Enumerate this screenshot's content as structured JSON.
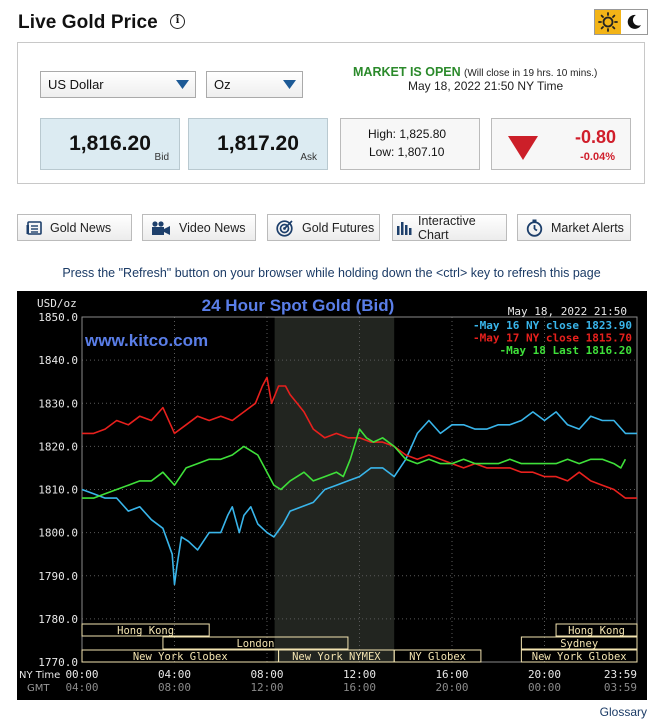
{
  "header": {
    "title": "Live Gold Price"
  },
  "selects": {
    "currency": "US Dollar",
    "unit": "Oz"
  },
  "market": {
    "status": "MARKET IS OPEN",
    "closes": "(Will close in 19 hrs. 10 mins.)",
    "time": "May 18, 2022 21:50 NY Time"
  },
  "prices": {
    "bid": "1,816.20",
    "bid_label": "Bid",
    "ask": "1,817.20",
    "ask_label": "Ask",
    "high": "High: 1,825.80",
    "low": "Low: 1,807.10",
    "change": "-0.80",
    "change_pct": "-0.04%"
  },
  "buttons": [
    {
      "label": "Gold News",
      "icon": "newspaper-icon"
    },
    {
      "label": "Video News",
      "icon": "video-camera-icon"
    },
    {
      "label": "Gold Futures",
      "icon": "target-icon"
    },
    {
      "label": "Interactive Chart",
      "icon": "bar-chart-icon"
    },
    {
      "label": "Market Alerts",
      "icon": "stopwatch-icon"
    }
  ],
  "notice": "Press the \"Refresh\" button on your browser while holding down the <ctrl> key to refresh this page",
  "glossary": "Glossary",
  "colors": {
    "may16": "#39b5ea",
    "may17": "#e8201d",
    "may18": "#3fe03a",
    "title": "#5a7ee8",
    "session_bg": "#f2e3b0"
  },
  "chart_data": {
    "type": "line",
    "title": "24 Hour Spot Gold (Bid)",
    "watermark": "www.kitco.com",
    "timestamp": "May 18, 2022 21:50",
    "ylabel": "USD/oz",
    "ylim": [
      1770,
      1850
    ],
    "yticks": [
      "1850.0",
      "1840.0",
      "1830.0",
      "1820.0",
      "1810.0",
      "1800.0",
      "1790.0",
      "1780.0",
      "1770.0"
    ],
    "x_unit": "hours NY time",
    "xlim": [
      0,
      24
    ],
    "xtick_ny": [
      "00:00",
      "04:00",
      "08:00",
      "12:00",
      "16:00",
      "20:00",
      "23:59"
    ],
    "xtick_gmt": [
      "04:00",
      "08:00",
      "12:00",
      "16:00",
      "20:00",
      "00:00",
      "03:59"
    ],
    "axis_row_labels": [
      "NY Time",
      "GMT"
    ],
    "shaded_range": [
      8.33,
      13.5
    ],
    "sessions": [
      {
        "label": "Hong Kong",
        "row": 0,
        "start": 0,
        "end": 5.5
      },
      {
        "label": "Hong Kong",
        "row": 0,
        "start": 20.5,
        "end": 24
      },
      {
        "label": "London",
        "row": 1,
        "start": 3.5,
        "end": 11.5
      },
      {
        "label": "Sydney",
        "row": 1,
        "start": 19,
        "end": 24
      },
      {
        "label": "New York Globex",
        "row": 2,
        "start": 0,
        "end": 8.5
      },
      {
        "label": "New York NYMEX",
        "row": 2,
        "start": 8.5,
        "end": 13.5
      },
      {
        "label": "NY Globex",
        "row": 2,
        "start": 13.5,
        "end": 17.25
      },
      {
        "label": "New York Globex",
        "row": 2,
        "start": 19,
        "end": 24
      }
    ],
    "series": [
      {
        "name": "May 16 NY close 1823.90",
        "color": "#39b5ea",
        "x": [
          0,
          0.5,
          1,
          1.5,
          2,
          2.5,
          3,
          3.5,
          3.9,
          4,
          4.1,
          4.3,
          4.6,
          5,
          5.5,
          6,
          6.3,
          6.5,
          6.8,
          7,
          7.3,
          7.6,
          8,
          8.3,
          8.7,
          9,
          9.5,
          10,
          10.5,
          11,
          11.5,
          12,
          12.5,
          13,
          13.5,
          14,
          14.5,
          15,
          15.5,
          16,
          16.5,
          17,
          17.5,
          18,
          18.5,
          19,
          19.5,
          20,
          20.5,
          21,
          21.5,
          22,
          22.5,
          23,
          23.5,
          24
        ],
        "y": [
          1810,
          1809,
          1808,
          1808,
          1805,
          1806,
          1803,
          1801,
          1795,
          1788,
          1792,
          1799,
          1798,
          1796,
          1800,
          1800,
          1804,
          1806,
          1800,
          1804,
          1806,
          1802,
          1800,
          1799,
          1802,
          1805,
          1806,
          1807,
          1810,
          1811,
          1812,
          1813,
          1815,
          1815,
          1813,
          1817,
          1823,
          1826,
          1823,
          1825,
          1825,
          1824,
          1824,
          1825,
          1825,
          1826,
          1828,
          1826,
          1828,
          1825,
          1824,
          1827,
          1826,
          1826,
          1823,
          1823
        ]
      },
      {
        "name": "May 17 NY close 1815.70",
        "color": "#e8201d",
        "x": [
          0,
          0.5,
          1,
          1.5,
          2,
          2.5,
          3,
          3.5,
          4,
          4.5,
          5,
          5.5,
          6,
          6.5,
          7,
          7.5,
          7.8,
          8,
          8.2,
          8.5,
          8.8,
          9,
          9.3,
          9.6,
          10,
          10.5,
          11,
          11.5,
          12,
          12.5,
          13,
          13.5,
          14,
          14.5,
          15,
          15.5,
          16,
          16.5,
          17,
          17.5,
          18,
          18.5,
          19,
          19.5,
          20,
          20.5,
          21,
          21.5,
          22,
          22.5,
          23,
          23.5,
          24
        ],
        "y": [
          1823,
          1823,
          1824,
          1826,
          1825,
          1827,
          1826,
          1829,
          1823,
          1825,
          1827,
          1826,
          1827,
          1826,
          1828,
          1830,
          1834,
          1836,
          1830,
          1834,
          1834,
          1832,
          1830,
          1828,
          1824,
          1822,
          1823,
          1822,
          1822,
          1821,
          1821,
          1820,
          1818,
          1817,
          1818,
          1817,
          1816,
          1815,
          1816,
          1815,
          1815,
          1815,
          1814,
          1814,
          1813,
          1813,
          1812,
          1814,
          1812,
          1811,
          1810,
          1808,
          1808
        ]
      },
      {
        "name": "May 18 Last 1816.20",
        "color": "#3fe03a",
        "x": [
          0,
          0.5,
          1,
          1.5,
          2,
          2.5,
          3,
          3.5,
          4,
          4.5,
          5,
          5.5,
          6,
          6.5,
          7,
          7.3,
          7.6,
          8,
          8.3,
          8.6,
          9,
          9.3,
          9.6,
          10,
          10.5,
          11,
          11.3,
          11.6,
          12,
          12.3,
          12.6,
          13,
          13.5,
          14,
          14.5,
          15,
          15.5,
          16,
          16.5,
          17,
          17.5,
          18,
          18.5,
          19,
          19.5,
          20,
          20.5,
          21,
          21.5,
          22,
          22.5,
          23,
          23.3,
          23.5
        ],
        "y": [
          1808,
          1808,
          1809,
          1810,
          1811,
          1812,
          1812,
          1814,
          1811,
          1815,
          1816,
          1817,
          1817,
          1818,
          1820,
          1819,
          1818,
          1814,
          1811,
          1810,
          1812,
          1813,
          1814,
          1812,
          1813,
          1814,
          1813,
          1817,
          1824,
          1822,
          1821,
          1822,
          1820,
          1817,
          1816,
          1817,
          1816,
          1816,
          1817,
          1816,
          1816,
          1816,
          1817,
          1816,
          1816,
          1816,
          1816,
          1817,
          1816,
          1817,
          1817,
          1816,
          1815,
          1817
        ]
      }
    ]
  }
}
